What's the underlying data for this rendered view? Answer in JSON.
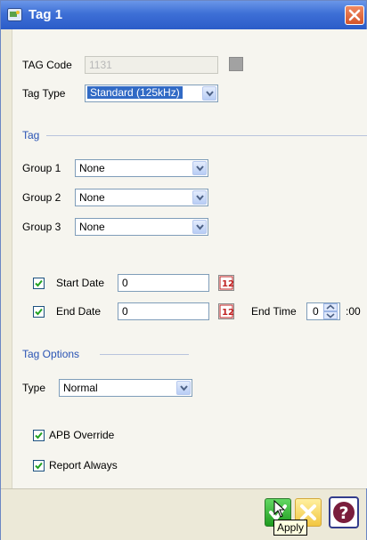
{
  "window": {
    "title": "Tag 1"
  },
  "tag_code": {
    "label": "TAG Code",
    "value": "1131"
  },
  "tag_type": {
    "label": "Tag Type",
    "value": "Standard (125kHz)"
  },
  "tag_section": {
    "title": "Tag"
  },
  "groups": [
    {
      "label": "Group 1",
      "value": "None"
    },
    {
      "label": "Group 2",
      "value": "None"
    },
    {
      "label": "Group 3",
      "value": "None"
    }
  ],
  "start_date": {
    "label": "Start Date",
    "value": "0",
    "checked": true
  },
  "end_date": {
    "label": "End Date",
    "value": "0",
    "checked": true
  },
  "end_time": {
    "label": "End Time",
    "value": "0",
    "suffix": ":00"
  },
  "tag_options": {
    "title": "Tag Options",
    "type_label": "Type",
    "type_value": "Normal"
  },
  "apb_override": {
    "label": "APB Override",
    "checked": true
  },
  "report_always": {
    "label": "Report Always",
    "checked": true
  },
  "footer": {
    "tooltip": "Apply"
  },
  "colors": {
    "title_bar": "#3d6fd6",
    "section_text": "#2a54b4",
    "selection": "#316ac5",
    "ok": "#1f9b1f",
    "cancel": "#f2c640",
    "help": "#7a1d3c"
  }
}
